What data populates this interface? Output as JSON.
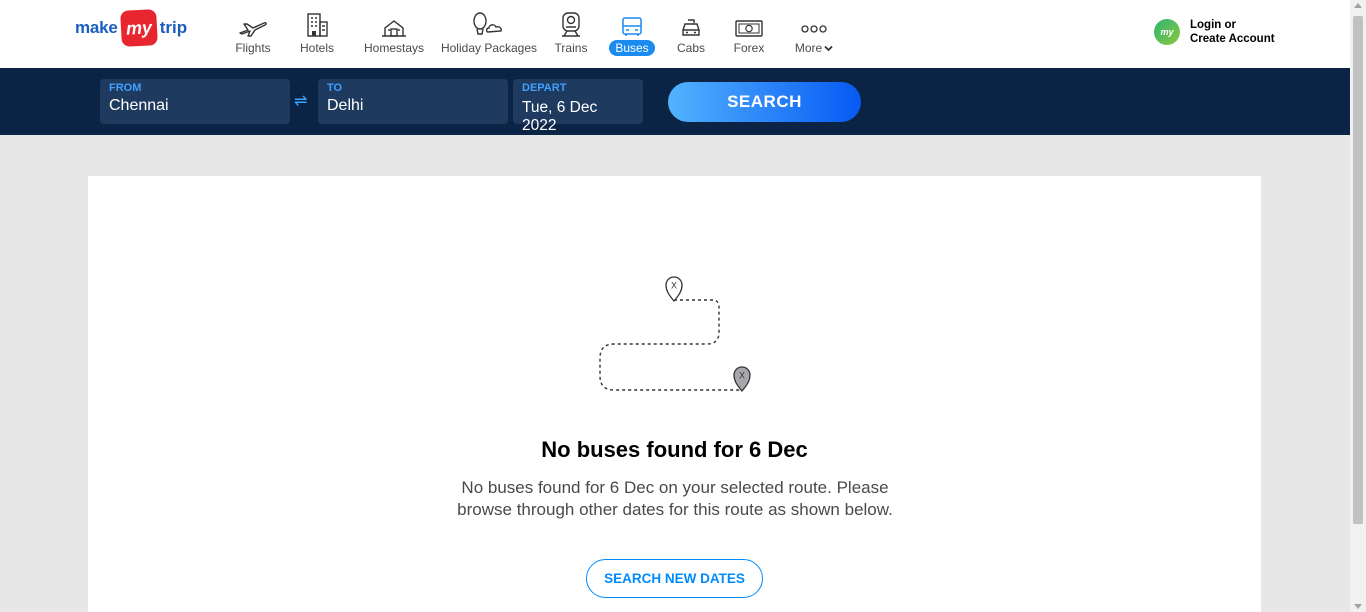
{
  "logo": {
    "make": "make",
    "my": "my",
    "trip": "trip"
  },
  "nav": {
    "items": [
      {
        "label": "Flights",
        "icon": "airplane-icon"
      },
      {
        "label": "Hotels",
        "icon": "hotel-building-icon"
      },
      {
        "label": "Homestays",
        "icon": "house-icon"
      },
      {
        "label": "Holiday Packages",
        "icon": "balloon-icon"
      },
      {
        "label": "Trains",
        "icon": "train-icon"
      },
      {
        "label": "Buses",
        "icon": "bus-icon",
        "active": true
      },
      {
        "label": "Cabs",
        "icon": "car-icon"
      },
      {
        "label": "Forex",
        "icon": "currency-icon"
      },
      {
        "label": "More",
        "icon": "more-dots-icon"
      }
    ]
  },
  "login": {
    "avatar": "my",
    "line1": "Login or",
    "line2": "Create Account"
  },
  "search": {
    "from": {
      "label": "FROM",
      "value": "Chennai"
    },
    "to": {
      "label": "TO",
      "value": "Delhi"
    },
    "depart": {
      "label": "DEPART",
      "value": "Tue, 6 Dec 2022"
    },
    "swap_icon": "⇌",
    "button": "SEARCH"
  },
  "result": {
    "title": "No buses found for 6 Dec",
    "description": "No buses found for 6 Dec on your selected route. Please browse through other dates for this route as shown below.",
    "button": "SEARCH NEW DATES",
    "pin_mark": "X"
  },
  "colors": {
    "brand_blue": "#1a5dbf",
    "brand_red": "#e8262f",
    "searchbar_bg": "#0b2446",
    "accent": "#008cff"
  }
}
